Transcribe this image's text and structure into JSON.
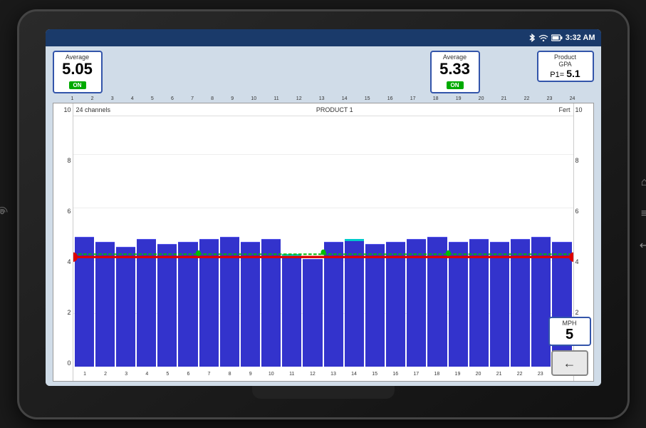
{
  "statusBar": {
    "time": "3:32 AM",
    "icons": [
      "bluetooth",
      "wifi",
      "battery"
    ]
  },
  "avg1": {
    "label": "Average",
    "value": "5.05",
    "on": "ON"
  },
  "avg2": {
    "label": "Average",
    "value": "5.33",
    "on": "ON"
  },
  "productGpa": {
    "title1": "Product",
    "title2": "GPA",
    "p1label": "P1=",
    "p1value": "5.1"
  },
  "chart": {
    "channelCount": "24 channels",
    "product": "PRODUCT 1",
    "fert": "Fert",
    "yMax": "10",
    "yMid": "",
    "yMin": "0",
    "xLabels": [
      "1",
      "2",
      "3",
      "4",
      "5",
      "6",
      "7",
      "8",
      "9",
      "10",
      "11",
      "12",
      "13",
      "14",
      "15",
      "16",
      "17",
      "18",
      "19",
      "20",
      "21",
      "22",
      "23",
      "24"
    ],
    "bars": [
      5.2,
      5.0,
      4.8,
      5.1,
      4.9,
      5.0,
      5.1,
      5.2,
      5.0,
      5.1,
      4.5,
      4.3,
      5.0,
      5.1,
      4.9,
      5.0,
      5.1,
      5.2,
      5.0,
      5.1,
      5.0,
      5.1,
      5.2,
      5.0
    ],
    "maxY": 10,
    "avgLine": 5.05,
    "topNumbers": [
      "1",
      "2",
      "3",
      "4",
      "5",
      "6",
      "7",
      "8",
      "9",
      "10",
      "11",
      "12",
      "13",
      "14",
      "15",
      "16",
      "17",
      "18",
      "19",
      "20",
      "21",
      "22",
      "23",
      "24"
    ]
  },
  "mph": {
    "label": "MPH",
    "value": "5"
  },
  "backButton": {
    "label": "←"
  },
  "sideNav": {
    "home": "⌂",
    "menu": "≡",
    "back": "↩"
  },
  "nfc": {
    "icon": "((·))"
  }
}
